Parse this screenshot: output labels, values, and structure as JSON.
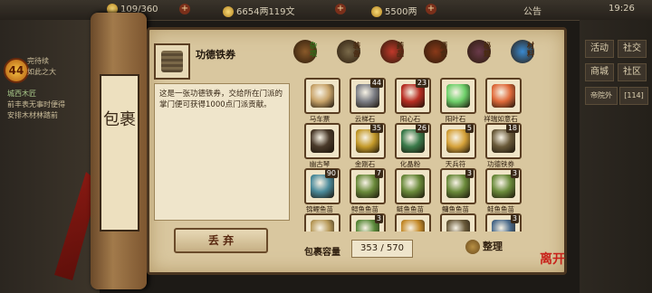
{
  "topbar": {
    "stat1": "109/360",
    "stat2": "6654两119文",
    "stat3": "5500两",
    "notice": "公告",
    "time": "19:26"
  },
  "quest": {
    "medal": "44",
    "lines": [
      "完待续",
      "如此之大",
      "城西木匠",
      "前丰表无事时便得",
      "安排木材林踏前"
    ]
  },
  "right_menu": [
    "活动",
    "社交",
    "商城",
    "社区",
    "帝院外",
    "[114]"
  ],
  "scroll": {
    "title": "包裹"
  },
  "detail": {
    "name": "功德铁券",
    "description": "这是一张功德铁券，交给所在门派的掌门便可获得1000点门派贡献。",
    "discard_label": "丢 弃"
  },
  "tabs": [
    {
      "label": "杂项",
      "icon": "misc-icon",
      "active": true
    },
    {
      "label": "装备",
      "icon": "equip-icon",
      "active": false
    },
    {
      "label": "药品",
      "icon": "medicine-icon",
      "active": false
    },
    {
      "label": "酒食",
      "icon": "food-icon",
      "active": false
    },
    {
      "label": "秘籍",
      "icon": "book-icon",
      "active": false
    },
    {
      "label": "材料",
      "icon": "material-icon",
      "active": false
    }
  ],
  "items": [
    {
      "name": "马车票",
      "count": "",
      "color": "#c9a46a"
    },
    {
      "name": "云梯石",
      "count": "44",
      "color": "#7d7f86"
    },
    {
      "name": "阳心石",
      "count": "23",
      "color": "#b82d22"
    },
    {
      "name": "阳叶石",
      "count": "",
      "color": "#6ed06a"
    },
    {
      "name": "祥瑞如意石",
      "count": "",
      "color": "#e06a3a"
    },
    {
      "name": "幽古琴",
      "count": "",
      "color": "#4a3a2a"
    },
    {
      "name": "金刚石",
      "count": "35",
      "color": "#c49a2a"
    },
    {
      "name": "化晶粉",
      "count": "26",
      "color": "#3a7a4a"
    },
    {
      "name": "天兵符",
      "count": "5",
      "color": "#d6a23a"
    },
    {
      "name": "功德铁券",
      "count": "18",
      "color": "#6a5a3a"
    },
    {
      "name": "锦鲤鱼苗",
      "count": "90",
      "color": "#4a8a9a"
    },
    {
      "name": "鲟鱼鱼苗",
      "count": "7",
      "color": "#6a8a3a"
    },
    {
      "name": "鲢鱼鱼苗",
      "count": "",
      "color": "#6a8a3a"
    },
    {
      "name": "鳙鱼鱼苗",
      "count": "3",
      "color": "#6a8a3a"
    },
    {
      "name": "鲑鱼鱼苗",
      "count": "3",
      "color": "#6a8a3a"
    },
    {
      "name": "",
      "count": "",
      "color": "#b89a5a"
    },
    {
      "name": "",
      "count": "3",
      "color": "#5a8a3a"
    },
    {
      "name": "",
      "count": "",
      "color": "#c48a2a"
    },
    {
      "name": "",
      "count": "",
      "color": "#6a5a3a"
    },
    {
      "name": "",
      "count": "3",
      "color": "#4a6a8a"
    }
  ],
  "capacity": {
    "label": "包裹容量",
    "value": "353 / 570"
  },
  "sort_label": "整理",
  "leave_label": "离开"
}
